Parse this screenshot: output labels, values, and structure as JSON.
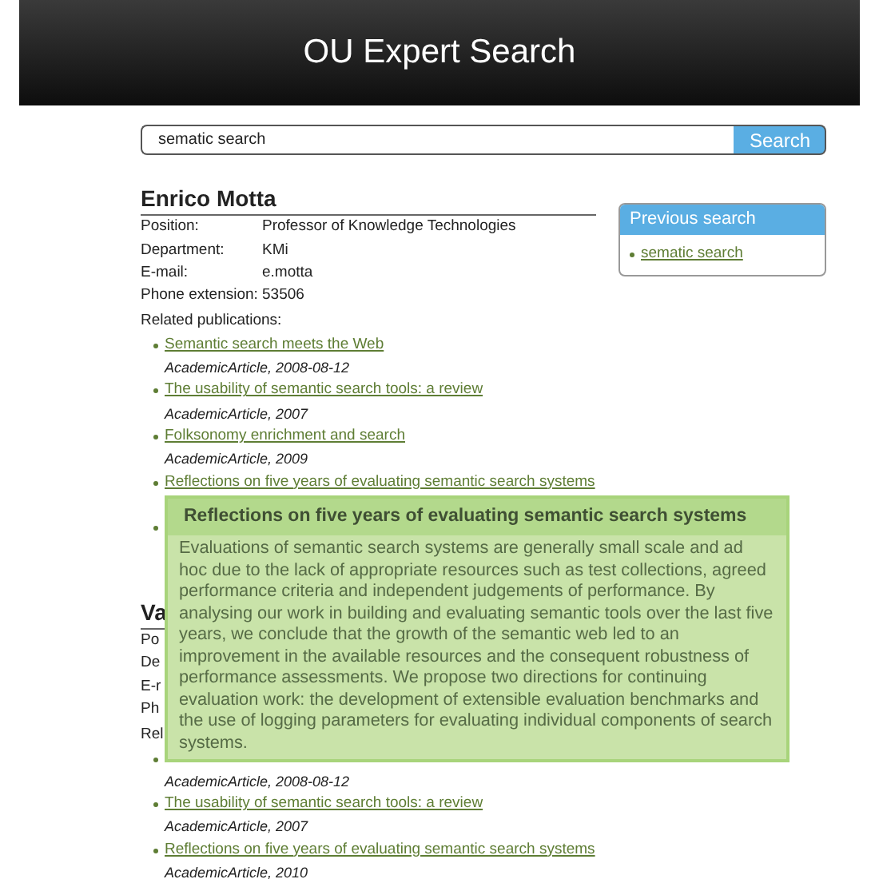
{
  "header": {
    "title": "OU Expert Search"
  },
  "search": {
    "value": "sematic search",
    "button": "Search"
  },
  "people": [
    {
      "name": "Enrico Motta",
      "fields": [
        {
          "label": "Position:",
          "value": "Professor of Knowledge Technologies"
        },
        {
          "label": "Department:",
          "value": "KMi"
        },
        {
          "label": "E-mail:",
          "value": "e.motta"
        },
        {
          "label": "Phone extension:",
          "value": "53506"
        }
      ],
      "publications_label": "Related publications:",
      "publications": [
        {
          "kind": "article",
          "title": "Semantic search meets the Web",
          "meta": "AcademicArticle, 2008-08-12"
        },
        {
          "kind": "article",
          "title": "The usability of semantic search tools: a review",
          "meta": "AcademicArticle, 2007"
        },
        {
          "kind": "article",
          "title": "Folksonomy enrichment and search",
          "meta": "AcademicArticle, 2009"
        },
        {
          "kind": "article",
          "title": "Reflections on five years of evaluating semantic search systems"
        },
        {
          "kind": "covered"
        }
      ]
    },
    {
      "name": "Va",
      "fields": [
        {
          "label": "Po"
        },
        {
          "label": "De"
        },
        {
          "label": "E-r"
        },
        {
          "label": "Ph"
        }
      ],
      "publications_label": "Rel",
      "publications": [
        {
          "kind": "article",
          "meta": "AcademicArticle, 2008-08-12"
        },
        {
          "kind": "article",
          "title": "The usability of semantic search tools: a review",
          "meta": "AcademicArticle, 2007"
        },
        {
          "kind": "article",
          "title": "Reflections on five years of evaluating semantic search systems",
          "meta": "AcademicArticle, 2010"
        }
      ]
    }
  ],
  "previous_search": {
    "title": "Previous search",
    "items": [
      "sematic search"
    ]
  },
  "tooltip": {
    "title": "Reflections on five years of evaluating semantic search systems",
    "text": "Evaluations of semantic search systems are generally small scale and ad hoc due to the lack of appropriate resources such as test collections, agreed performance criteria and independent judgements of performance. By analysing our work in building and evaluating semantic tools over the last five years, we conclude that the growth of the semantic web led to an improvement in the available resources and the consequent robustness of performance assessments. We propose two directions for continuing evaluation work: the development of extensible evaluation benchmarks and the use of logging parameters for evaluating individual components of search systems."
  }
}
